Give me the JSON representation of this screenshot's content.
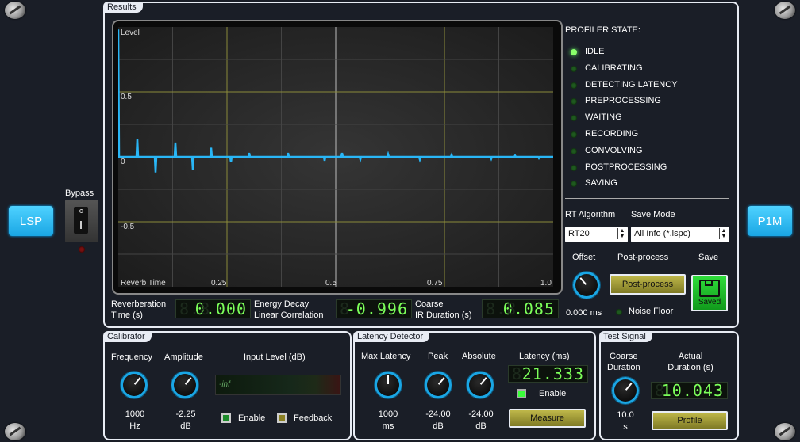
{
  "brand_left": "LSP",
  "brand_right": "P1M",
  "bypass": {
    "label": "Bypass"
  },
  "results": {
    "title": "Results",
    "graph": {
      "y_ticks": [
        "Level",
        "0.5",
        "0",
        "-0.5"
      ],
      "x_ticks": [
        "Reverb Time",
        "0.25",
        "0.5",
        "0.75",
        "1.0"
      ]
    },
    "readouts": [
      {
        "label1": "Reverberation",
        "label2": "Time (s)",
        "value": "0.000",
        "ghost": "8.8"
      },
      {
        "label1": "Energy Decay",
        "label2": "Linear Correlation",
        "value": "-0.996",
        "ghost": "8"
      },
      {
        "label1": "Coarse",
        "label2": "IR Duration (s)",
        "value": "0.085",
        "ghost": "8.8"
      }
    ],
    "profiler_state": {
      "title": "PROFILER STATE:",
      "states": [
        "IDLE",
        "CALIBRATING",
        "DETECTING LATENCY",
        "PREPROCESSING",
        "WAITING",
        "RECORDING",
        "CONVOLVING",
        "POSTPROCESSING",
        "SAVING"
      ],
      "active_index": 0
    },
    "rt_algorithm": {
      "label": "RT Algorithm",
      "value": "RT20"
    },
    "save_mode": {
      "label": "Save Mode",
      "value": "All Info (*.lspc)"
    },
    "offset": {
      "label": "Offset",
      "value": "0.000 ms"
    },
    "post_process": {
      "label": "Post-process",
      "button": "Post-process",
      "noise_floor": "Noise Floor"
    },
    "save": {
      "label": "Save",
      "status": "Saved"
    }
  },
  "calibrator": {
    "title": "Calibrator",
    "frequency": {
      "label": "Frequency",
      "value": "1000",
      "unit": "Hz"
    },
    "amplitude": {
      "label": "Amplitude",
      "value": "-2.25",
      "unit": "dB"
    },
    "input_level": {
      "label": "Input Level (dB)",
      "value": "-inf"
    },
    "enable": "Enable",
    "feedback": "Feedback"
  },
  "latency": {
    "title": "Latency Detector",
    "max_latency": {
      "label": "Max Latency",
      "value": "1000",
      "unit": "ms"
    },
    "peak": {
      "label": "Peak",
      "value": "-24.00",
      "unit": "dB"
    },
    "absolute": {
      "label": "Absolute",
      "value": "-24.00",
      "unit": "dB"
    },
    "latency_ms": {
      "label": "Latency (ms)",
      "value": "21.333"
    },
    "enable": "Enable",
    "measure": "Measure"
  },
  "test_signal": {
    "title": "Test Signal",
    "coarse": {
      "label1": "Coarse",
      "label2": "Duration",
      "value": "10.0",
      "unit": "s"
    },
    "actual": {
      "label1": "Actual",
      "label2": "Duration (s)",
      "value": "10.043"
    },
    "profile": "Profile"
  },
  "colors": {
    "accent": "#1aa6e4",
    "lcd": "#7cff5a",
    "button": "#bfb84a"
  }
}
